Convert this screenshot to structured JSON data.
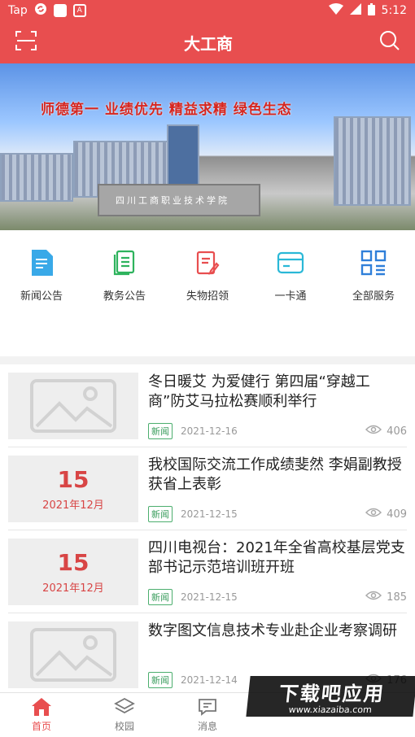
{
  "status_bar": {
    "left_label": "Tap",
    "small_badge": "A",
    "time": "5:12"
  },
  "app_bar": {
    "title": "大工商",
    "scan_icon": "scan-icon",
    "search_icon": "search-icon"
  },
  "banner": {
    "slogan": "师德第一  业绩优先  精益求精  绿色生态",
    "gate_text": "四川工商职业技术学院"
  },
  "quick_menu": [
    {
      "label": "新闻公告",
      "icon": "news-icon",
      "color": "#39a9e8"
    },
    {
      "label": "教务公告",
      "icon": "academic-notice-icon",
      "color": "#2eb35d"
    },
    {
      "label": "失物招领",
      "icon": "lost-found-icon",
      "color": "#e84e4f"
    },
    {
      "label": "一卡通",
      "icon": "card-icon",
      "color": "#2ab8d7"
    },
    {
      "label": "全部服务",
      "icon": "all-services-icon",
      "color": "#2f7fd9"
    }
  ],
  "news": [
    {
      "thumb": "image",
      "title": "冬日暖艾  为爱健行  第四届“穿越工商”防艾马拉松赛顺利举行",
      "tag": "新闻",
      "date": "2021-12-16",
      "views": "406"
    },
    {
      "thumb": "date",
      "day": "15",
      "ym": "2021年12月",
      "title": "我校国际交流工作成绩斐然  李娟副教授获省上表彰",
      "tag": "新闻",
      "date": "2021-12-15",
      "views": "409"
    },
    {
      "thumb": "date",
      "day": "15",
      "ym": "2021年12月",
      "title": "四川电视台：2021年全省高校基层党支部书记示范培训班开班",
      "tag": "新闻",
      "date": "2021-12-15",
      "views": "185"
    },
    {
      "thumb": "image",
      "title": "数字图文信息技术专业赴企业考察调研",
      "tag": "新闻",
      "date": "2021-12-14",
      "views": "176"
    }
  ],
  "tab_bar": [
    {
      "label": "首页",
      "icon": "home-icon",
      "active": true
    },
    {
      "label": "校园",
      "icon": "layers-icon",
      "active": false
    },
    {
      "label": "消息",
      "icon": "message-icon",
      "active": false
    },
    {
      "label": "",
      "icon": "",
      "active": false
    },
    {
      "label": "",
      "icon": "",
      "active": false
    }
  ],
  "watermark": {
    "line1": "下载吧应用",
    "line2": "www.xiazaiba.com"
  },
  "colors": {
    "brand": "#e84e4f",
    "tag_green": "#3a9d5d"
  }
}
